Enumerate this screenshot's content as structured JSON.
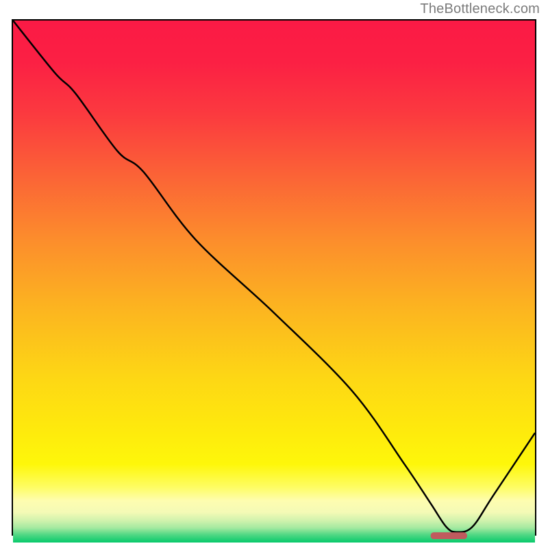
{
  "watermark": "TheBottleneck.com",
  "chart_data": {
    "type": "line",
    "title": "",
    "xlabel": "",
    "ylabel": "",
    "xlim": [
      0,
      100
    ],
    "ylim": [
      0,
      100
    ],
    "series": [
      {
        "name": "bottleneck-curve",
        "x": [
          0,
          8,
          12,
          20,
          25,
          35,
          50,
          65,
          75,
          80,
          83,
          85,
          88,
          92,
          100
        ],
        "values": [
          100,
          90,
          86,
          75,
          71,
          58,
          44,
          29,
          15,
          7.5,
          3,
          2,
          3,
          9,
          21
        ],
        "color": "#000000"
      },
      {
        "name": "optimal-marker",
        "x": [
          80,
          87
        ],
        "values": [
          1.3,
          1.3
        ],
        "color": "#c05a5e"
      }
    ],
    "gradient_stops": [
      {
        "pos": 0.0,
        "color": "#fb1a45"
      },
      {
        "pos": 0.08,
        "color": "#fb2044"
      },
      {
        "pos": 0.18,
        "color": "#fb3a3f"
      },
      {
        "pos": 0.3,
        "color": "#fb6436"
      },
      {
        "pos": 0.42,
        "color": "#fc8d2c"
      },
      {
        "pos": 0.55,
        "color": "#fcb420"
      },
      {
        "pos": 0.68,
        "color": "#fdd615"
      },
      {
        "pos": 0.78,
        "color": "#fee90d"
      },
      {
        "pos": 0.85,
        "color": "#fef70a"
      },
      {
        "pos": 0.895,
        "color": "#fefd66"
      },
      {
        "pos": 0.92,
        "color": "#fefdb0"
      },
      {
        "pos": 0.942,
        "color": "#f4fab6"
      },
      {
        "pos": 0.958,
        "color": "#d0f2ad"
      },
      {
        "pos": 0.972,
        "color": "#a4e9a0"
      },
      {
        "pos": 0.985,
        "color": "#51d884"
      },
      {
        "pos": 1.0,
        "color": "#07c96b"
      }
    ]
  }
}
